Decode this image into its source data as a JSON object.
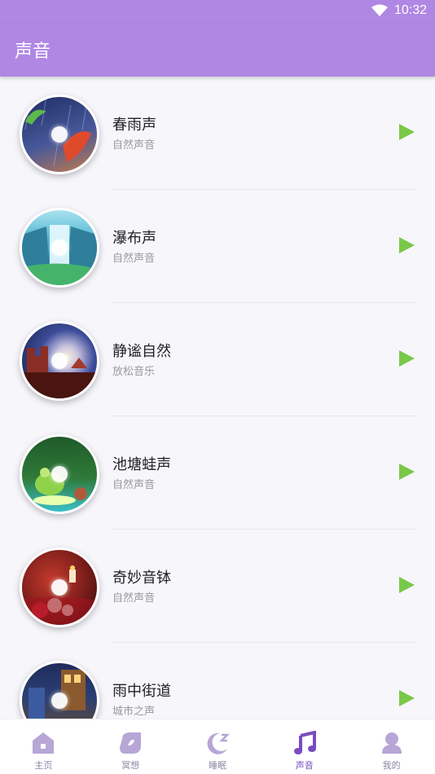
{
  "status": {
    "time": "10:32"
  },
  "header": {
    "title": "声音"
  },
  "sounds": [
    {
      "title": "春雨声",
      "subtitle": "自然声音",
      "icon": "spring-rain"
    },
    {
      "title": "瀑布声",
      "subtitle": "自然声音",
      "icon": "waterfall"
    },
    {
      "title": "静谧自然",
      "subtitle": "放松音乐",
      "icon": "quiet-nature"
    },
    {
      "title": "池塘蛙声",
      "subtitle": "自然声音",
      "icon": "pond-frog"
    },
    {
      "title": "奇妙音钵",
      "subtitle": "自然声音",
      "icon": "singing-bowl"
    },
    {
      "title": "雨中街道",
      "subtitle": "城市之声",
      "icon": "rainy-street"
    }
  ],
  "nav": [
    {
      "label": "主页",
      "icon": "home-icon"
    },
    {
      "label": "冥想",
      "icon": "meditation-icon"
    },
    {
      "label": "睡眠",
      "icon": "moon-icon"
    },
    {
      "label": "声音",
      "icon": "music-note-icon",
      "active": true
    },
    {
      "label": "我的",
      "icon": "profile-icon"
    }
  ],
  "colors": {
    "header": "#b087e3",
    "play": "#79c84a",
    "active": "#7a4bc0",
    "inactiveIcon": "#b7a6d6"
  }
}
